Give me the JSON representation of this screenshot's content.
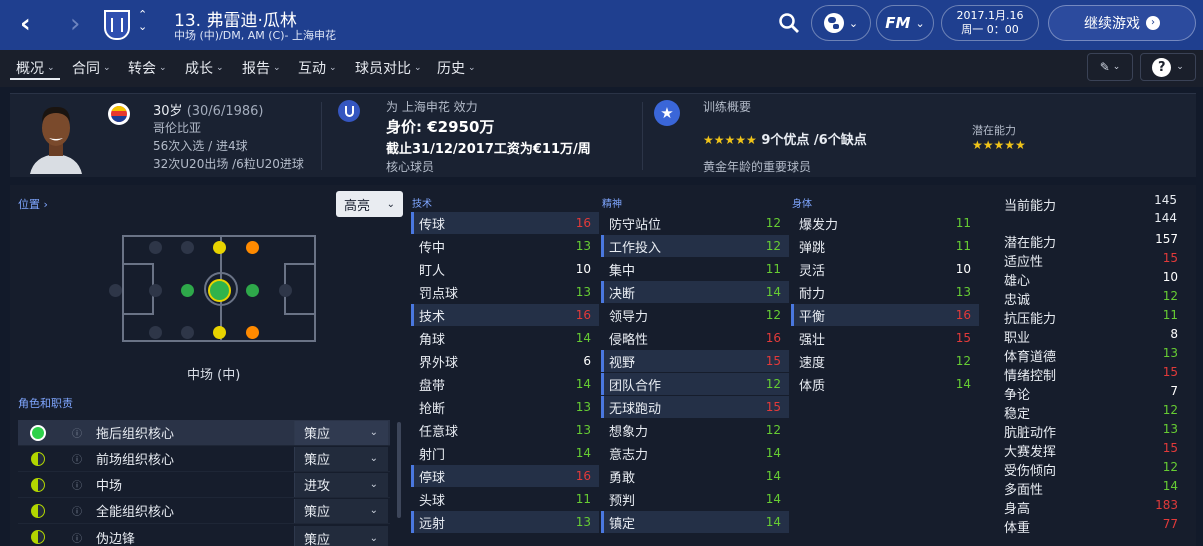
{
  "topbar": {
    "back_icon": "chevron-left-icon",
    "forward_icon": "chevron-right-icon",
    "player_title": "13. 弗雷迪·瓜林",
    "player_sub": "中场 (中)/DM, AM (C)- 上海申花",
    "date": "2017.1月.16",
    "time": "周一 0：00",
    "continue_label": "继续游戏",
    "fm_label": "FM"
  },
  "nav": [
    "概况",
    "合同",
    "转会",
    "成长",
    "报告",
    "互动",
    "球员对比",
    "历史"
  ],
  "header": {
    "age": "30岁",
    "dob": "(30/6/1986)",
    "nation": "哥伦比亚",
    "caps": "56次入选 / 进4球",
    "u20": "32次U20出场 /6粒U20进球",
    "club_line": "为 上海申花 效力",
    "value": "身价: €2950万",
    "contract": "截止31/12/2017工资为€11万/周",
    "squad_role": "核心球员",
    "training_title": "训练概要",
    "strengths": "9个优点 /6个缺点",
    "strength_stars": "★★★★★",
    "training_desc": "黄金年龄的重要球员",
    "potential_label": "潜在能力",
    "potential_stars": "★★★★★"
  },
  "position": {
    "label": "位置 ›",
    "highlight_label": "高亮",
    "pos_name": "中场 (中)",
    "roles_label": "角色和职责"
  },
  "roles": [
    {
      "name": "拖后组织核心",
      "duty": "策应"
    },
    {
      "name": "前场组织核心",
      "duty": "策应"
    },
    {
      "name": "中场",
      "duty": "进攻"
    },
    {
      "name": "全能组织核心",
      "duty": "策应"
    },
    {
      "name": "伪边锋",
      "duty": "策应"
    }
  ],
  "attributes": {
    "technical_label": "技术",
    "mental_label": "精神",
    "physical_label": "身体",
    "technical": [
      {
        "name": "传球",
        "value": "16",
        "hl": true
      },
      {
        "name": "传中",
        "value": "13",
        "hl": false
      },
      {
        "name": "盯人",
        "value": "10",
        "hl": false
      },
      {
        "name": "罚点球",
        "value": "13",
        "hl": false
      },
      {
        "name": "技术",
        "value": "16",
        "hl": true
      },
      {
        "name": "角球",
        "value": "14",
        "hl": false
      },
      {
        "name": "界外球",
        "value": "6",
        "hl": false
      },
      {
        "name": "盘带",
        "value": "14",
        "hl": false
      },
      {
        "name": "抢断",
        "value": "13",
        "hl": false
      },
      {
        "name": "任意球",
        "value": "13",
        "hl": false
      },
      {
        "name": "射门",
        "value": "14",
        "hl": false
      },
      {
        "name": "停球",
        "value": "16",
        "hl": true
      },
      {
        "name": "头球",
        "value": "11",
        "hl": false
      },
      {
        "name": "远射",
        "value": "13",
        "hl": true
      }
    ],
    "mental": [
      {
        "name": "防守站位",
        "value": "12",
        "hl": false
      },
      {
        "name": "工作投入",
        "value": "12",
        "hl": true
      },
      {
        "name": "集中",
        "value": "11",
        "hl": false
      },
      {
        "name": "决断",
        "value": "14",
        "hl": true
      },
      {
        "name": "领导力",
        "value": "12",
        "hl": false
      },
      {
        "name": "侵略性",
        "value": "16",
        "hl": false
      },
      {
        "name": "视野",
        "value": "15",
        "hl": true
      },
      {
        "name": "团队合作",
        "value": "12",
        "hl": true
      },
      {
        "name": "无球跑动",
        "value": "15",
        "hl": true
      },
      {
        "name": "想象力",
        "value": "12",
        "hl": false
      },
      {
        "name": "意志力",
        "value": "14",
        "hl": false
      },
      {
        "name": "勇敢",
        "value": "14",
        "hl": false
      },
      {
        "name": "预判",
        "value": "14",
        "hl": false
      },
      {
        "name": "镇定",
        "value": "14",
        "hl": true
      }
    ],
    "physical": [
      {
        "name": "爆发力",
        "value": "11",
        "hl": false
      },
      {
        "name": "弹跳",
        "value": "11",
        "hl": false
      },
      {
        "name": "灵活",
        "value": "10",
        "hl": false
      },
      {
        "name": "耐力",
        "value": "13",
        "hl": false
      },
      {
        "name": "平衡",
        "value": "16",
        "hl": true
      },
      {
        "name": "强壮",
        "value": "15",
        "hl": false
      },
      {
        "name": "速度",
        "value": "12",
        "hl": false
      },
      {
        "name": "体质",
        "value": "14",
        "hl": false
      }
    ]
  },
  "hidden": {
    "ca_label": "当前能力",
    "ca_values": [
      "145",
      "144"
    ],
    "items": [
      {
        "name": "潜在能力",
        "value": "157"
      },
      {
        "name": "适应性",
        "value": "15"
      },
      {
        "name": "雄心",
        "value": "10"
      },
      {
        "name": "忠诚",
        "value": "12"
      },
      {
        "name": "抗压能力",
        "value": "11"
      },
      {
        "name": "职业",
        "value": "8"
      },
      {
        "name": "体育道德",
        "value": "13"
      },
      {
        "name": "情绪控制",
        "value": "15"
      },
      {
        "name": "争论",
        "value": "7"
      },
      {
        "name": "稳定",
        "value": "12"
      },
      {
        "name": "肮脏动作",
        "value": "13"
      },
      {
        "name": "大赛发挥",
        "value": "15"
      },
      {
        "name": "受伤倾向",
        "value": "12"
      },
      {
        "name": "多面性",
        "value": "14"
      },
      {
        "name": "身高",
        "value": "183"
      },
      {
        "name": "体重",
        "value": "77"
      }
    ]
  },
  "colors": {
    "low": "#ffffff",
    "mid": "#ffffff",
    "good": "#66cc33",
    "high": "#e23a3a"
  }
}
